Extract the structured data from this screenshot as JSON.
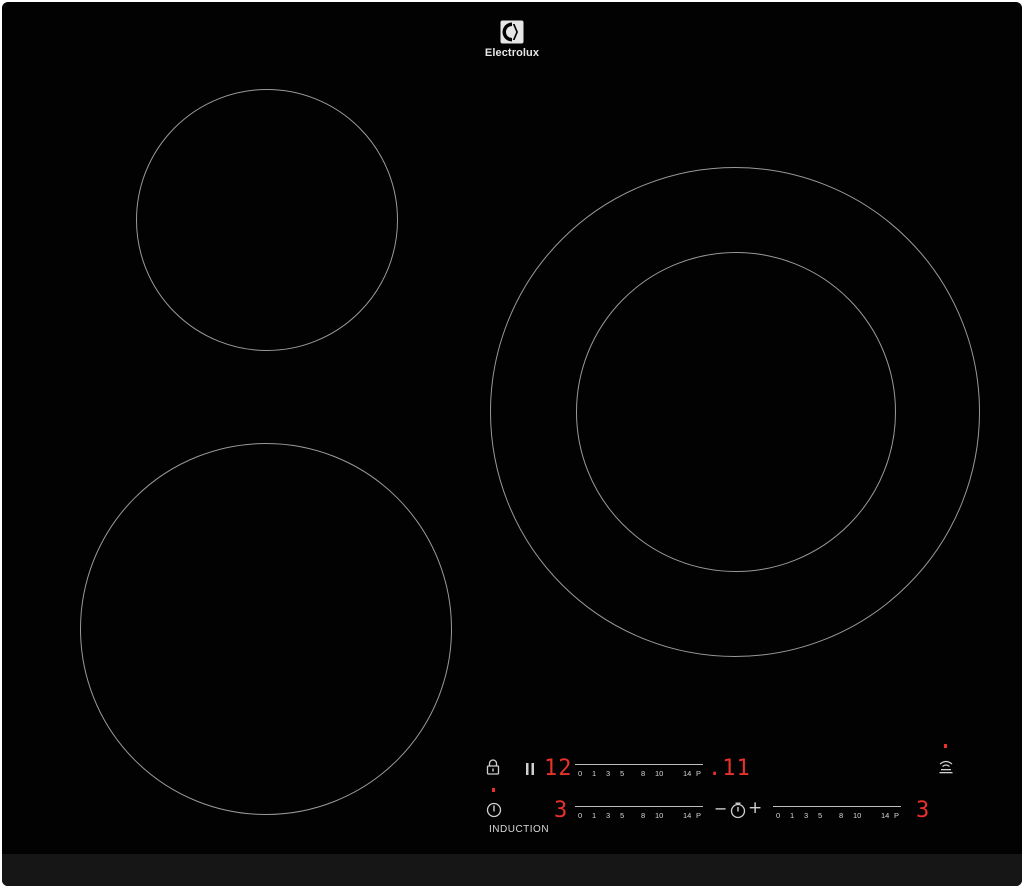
{
  "brand": {
    "name": "Electrolux",
    "logo": "electrolux-logo-icon"
  },
  "panel": {
    "row1": {
      "lock_icon": "lock-icon",
      "pause_icon": "pause-icon",
      "power_display": "12",
      "slider_ticks": [
        "0",
        "1",
        "3",
        "5",
        "8",
        "10",
        "14",
        "P"
      ],
      "timer_display": ".11"
    },
    "row2": {
      "power_icon": "power-icon",
      "left_display": "3",
      "left_slider_ticks": [
        "0",
        "1",
        "3",
        "5",
        "8",
        "10",
        "14",
        "P"
      ],
      "timer_minus": "−",
      "timer_icon": "timer-icon",
      "timer_plus": "+",
      "right_slider_ticks": [
        "0",
        "1",
        "3",
        "5",
        "8",
        "10",
        "14",
        "P"
      ],
      "right_display": "3"
    },
    "hob2hood_icon": "hob2hood-icon",
    "label": "INDUCTION"
  },
  "colors": {
    "display_red": "#e8312b",
    "glass": "#020202",
    "zone_line": "#9a9a9a"
  }
}
